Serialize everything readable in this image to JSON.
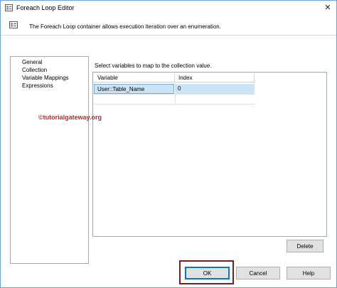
{
  "window": {
    "title": "Foreach Loop Editor",
    "close_glyph": "✕",
    "header_text": "The Foreach Loop container allows execution iteration over an enumeration."
  },
  "nav": {
    "items": [
      {
        "label": "General"
      },
      {
        "label": "Collection"
      },
      {
        "label": "Variable Mappings"
      },
      {
        "label": "Expressions"
      }
    ],
    "selected": "Variable Mappings"
  },
  "main": {
    "instruction": "Select variables to map to the collection value.",
    "columns": [
      "Variable",
      "Index"
    ],
    "rows": [
      {
        "variable": "User::Table_Name",
        "index": "0"
      }
    ],
    "watermark": "©tutorialgateway.org",
    "delete_label": "Delete"
  },
  "footer": {
    "ok_label": "OK",
    "cancel_label": "Cancel",
    "help_label": "Help"
  },
  "colors": {
    "selected_row": "#cce4f7",
    "highlight_border": "#7b1a28",
    "watermark": "#ba2b2b"
  },
  "icons": {
    "title": "foreach-loop-icon",
    "header": "foreach-loop-icon",
    "close": "close-icon"
  }
}
